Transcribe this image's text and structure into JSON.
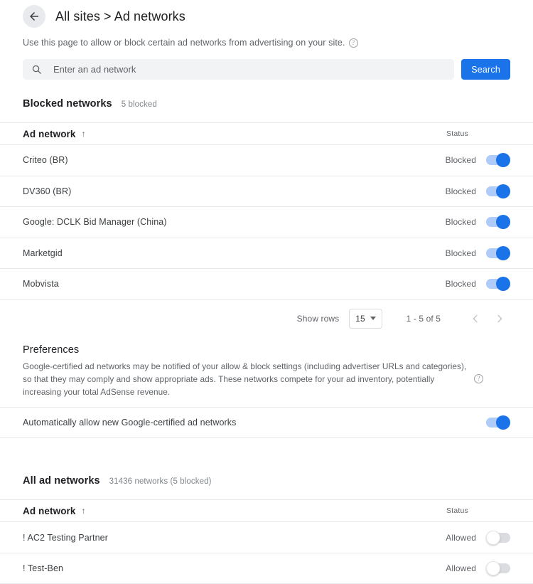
{
  "header": {
    "back_icon": "arrow-left-icon",
    "title": "All sites > Ad networks"
  },
  "description": {
    "text": "Use this page to allow or block certain ad networks from advertising on your site.",
    "help_icon": "help-icon"
  },
  "search": {
    "icon": "search-icon",
    "placeholder": "Enter an ad network",
    "value": "",
    "button_label": "Search"
  },
  "blocked_section": {
    "title": "Blocked networks",
    "meta": "5 blocked",
    "columns": {
      "name": "Ad network",
      "sort_indicator": "↑",
      "status": "Status"
    },
    "rows": [
      {
        "name": "Criteo (BR)",
        "status": "Blocked",
        "toggle": "on"
      },
      {
        "name": "DV360 (BR)",
        "status": "Blocked",
        "toggle": "on"
      },
      {
        "name": "Google: DCLK Bid Manager (China)",
        "status": "Blocked",
        "toggle": "on"
      },
      {
        "name": "Marketgid",
        "status": "Blocked",
        "toggle": "on"
      },
      {
        "name": "Mobvista",
        "status": "Blocked",
        "toggle": "on"
      }
    ],
    "pager": {
      "show_rows_label": "Show rows",
      "rows_per_page": "15",
      "range": "1 - 5 of 5",
      "prev_icon": "chevron-left-icon",
      "next_icon": "chevron-right-icon"
    }
  },
  "preferences": {
    "title": "Preferences",
    "text": "Google-certified ad networks may be notified of your allow & block settings (including advertiser URLs and categories), so that they may comply and show appropriate ads. These networks compete for your ad inventory, potentially increasing your total AdSense revenue.",
    "help_icon": "help-icon",
    "auto_allow_label": "Automatically allow new Google-certified ad networks",
    "auto_allow_toggle": "on"
  },
  "all_section": {
    "title": "All ad networks",
    "meta": "31436 networks (5 blocked)",
    "columns": {
      "name": "Ad network",
      "sort_indicator": "↑",
      "status": "Status"
    },
    "rows": [
      {
        "name": "! AC2 Testing Partner",
        "status": "Allowed",
        "toggle": "off"
      },
      {
        "name": "! Test-Ben",
        "status": "Allowed",
        "toggle": "off"
      }
    ]
  },
  "colors": {
    "accent": "#1a73e8",
    "toggle_on_track": "#aecbfa",
    "toggle_off_track": "#dadce0",
    "search_bg": "#f1f3f4",
    "divider": "#e8eaed"
  }
}
